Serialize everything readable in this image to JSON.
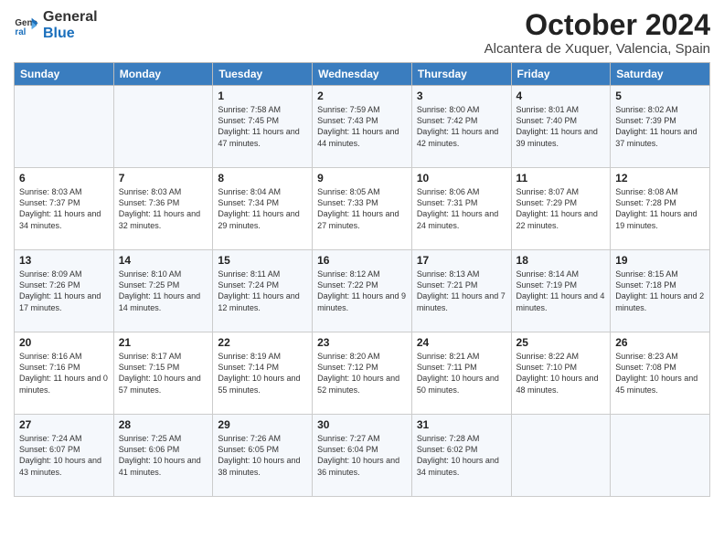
{
  "logo": {
    "line1": "General",
    "line2": "Blue"
  },
  "title": "October 2024",
  "subtitle": "Alcantera de Xuquer, Valencia, Spain",
  "weekdays": [
    "Sunday",
    "Monday",
    "Tuesday",
    "Wednesday",
    "Thursday",
    "Friday",
    "Saturday"
  ],
  "weeks": [
    [
      {
        "day": "",
        "info": ""
      },
      {
        "day": "",
        "info": ""
      },
      {
        "day": "1",
        "info": "Sunrise: 7:58 AM\nSunset: 7:45 PM\nDaylight: 11 hours and 47 minutes."
      },
      {
        "day": "2",
        "info": "Sunrise: 7:59 AM\nSunset: 7:43 PM\nDaylight: 11 hours and 44 minutes."
      },
      {
        "day": "3",
        "info": "Sunrise: 8:00 AM\nSunset: 7:42 PM\nDaylight: 11 hours and 42 minutes."
      },
      {
        "day": "4",
        "info": "Sunrise: 8:01 AM\nSunset: 7:40 PM\nDaylight: 11 hours and 39 minutes."
      },
      {
        "day": "5",
        "info": "Sunrise: 8:02 AM\nSunset: 7:39 PM\nDaylight: 11 hours and 37 minutes."
      }
    ],
    [
      {
        "day": "6",
        "info": "Sunrise: 8:03 AM\nSunset: 7:37 PM\nDaylight: 11 hours and 34 minutes."
      },
      {
        "day": "7",
        "info": "Sunrise: 8:03 AM\nSunset: 7:36 PM\nDaylight: 11 hours and 32 minutes."
      },
      {
        "day": "8",
        "info": "Sunrise: 8:04 AM\nSunset: 7:34 PM\nDaylight: 11 hours and 29 minutes."
      },
      {
        "day": "9",
        "info": "Sunrise: 8:05 AM\nSunset: 7:33 PM\nDaylight: 11 hours and 27 minutes."
      },
      {
        "day": "10",
        "info": "Sunrise: 8:06 AM\nSunset: 7:31 PM\nDaylight: 11 hours and 24 minutes."
      },
      {
        "day": "11",
        "info": "Sunrise: 8:07 AM\nSunset: 7:29 PM\nDaylight: 11 hours and 22 minutes."
      },
      {
        "day": "12",
        "info": "Sunrise: 8:08 AM\nSunset: 7:28 PM\nDaylight: 11 hours and 19 minutes."
      }
    ],
    [
      {
        "day": "13",
        "info": "Sunrise: 8:09 AM\nSunset: 7:26 PM\nDaylight: 11 hours and 17 minutes."
      },
      {
        "day": "14",
        "info": "Sunrise: 8:10 AM\nSunset: 7:25 PM\nDaylight: 11 hours and 14 minutes."
      },
      {
        "day": "15",
        "info": "Sunrise: 8:11 AM\nSunset: 7:24 PM\nDaylight: 11 hours and 12 minutes."
      },
      {
        "day": "16",
        "info": "Sunrise: 8:12 AM\nSunset: 7:22 PM\nDaylight: 11 hours and 9 minutes."
      },
      {
        "day": "17",
        "info": "Sunrise: 8:13 AM\nSunset: 7:21 PM\nDaylight: 11 hours and 7 minutes."
      },
      {
        "day": "18",
        "info": "Sunrise: 8:14 AM\nSunset: 7:19 PM\nDaylight: 11 hours and 4 minutes."
      },
      {
        "day": "19",
        "info": "Sunrise: 8:15 AM\nSunset: 7:18 PM\nDaylight: 11 hours and 2 minutes."
      }
    ],
    [
      {
        "day": "20",
        "info": "Sunrise: 8:16 AM\nSunset: 7:16 PM\nDaylight: 11 hours and 0 minutes."
      },
      {
        "day": "21",
        "info": "Sunrise: 8:17 AM\nSunset: 7:15 PM\nDaylight: 10 hours and 57 minutes."
      },
      {
        "day": "22",
        "info": "Sunrise: 8:19 AM\nSunset: 7:14 PM\nDaylight: 10 hours and 55 minutes."
      },
      {
        "day": "23",
        "info": "Sunrise: 8:20 AM\nSunset: 7:12 PM\nDaylight: 10 hours and 52 minutes."
      },
      {
        "day": "24",
        "info": "Sunrise: 8:21 AM\nSunset: 7:11 PM\nDaylight: 10 hours and 50 minutes."
      },
      {
        "day": "25",
        "info": "Sunrise: 8:22 AM\nSunset: 7:10 PM\nDaylight: 10 hours and 48 minutes."
      },
      {
        "day": "26",
        "info": "Sunrise: 8:23 AM\nSunset: 7:08 PM\nDaylight: 10 hours and 45 minutes."
      }
    ],
    [
      {
        "day": "27",
        "info": "Sunrise: 7:24 AM\nSunset: 6:07 PM\nDaylight: 10 hours and 43 minutes."
      },
      {
        "day": "28",
        "info": "Sunrise: 7:25 AM\nSunset: 6:06 PM\nDaylight: 10 hours and 41 minutes."
      },
      {
        "day": "29",
        "info": "Sunrise: 7:26 AM\nSunset: 6:05 PM\nDaylight: 10 hours and 38 minutes."
      },
      {
        "day": "30",
        "info": "Sunrise: 7:27 AM\nSunset: 6:04 PM\nDaylight: 10 hours and 36 minutes."
      },
      {
        "day": "31",
        "info": "Sunrise: 7:28 AM\nSunset: 6:02 PM\nDaylight: 10 hours and 34 minutes."
      },
      {
        "day": "",
        "info": ""
      },
      {
        "day": "",
        "info": ""
      }
    ]
  ]
}
